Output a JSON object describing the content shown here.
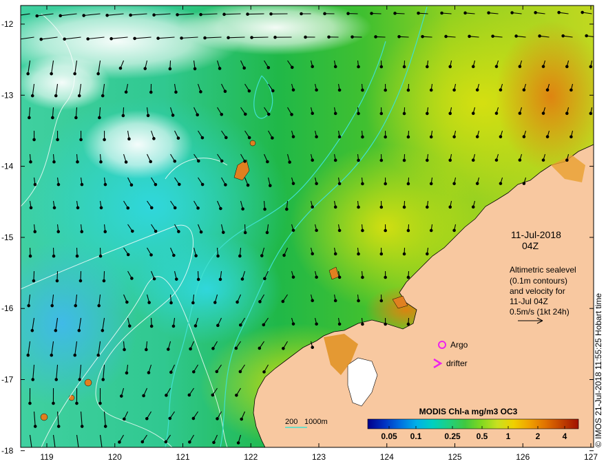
{
  "map": {
    "lat_ticks": [
      "-12",
      "-13",
      "-14",
      "-15",
      "-16",
      "-17",
      "-18"
    ],
    "lon_ticks": [
      "119",
      "120",
      "121",
      "122",
      "123",
      "124",
      "125",
      "126",
      "127"
    ],
    "date": "11-Jul-2018",
    "time": "04Z",
    "info_lines": [
      "Altimetric sealevel",
      "(0.1m contours)",
      "and velocity for",
      "11-Jul 04Z",
      "0.5m/s (1kt 24h)"
    ],
    "legend": {
      "argo_label": "Argo",
      "drifter_label": "drifter",
      "argo_color": "#ee22ee",
      "drifter_color": "#ee22ee"
    },
    "depth_key": {
      "label_200": "200",
      "label_1000": "1000m",
      "color": "#40e0d0"
    },
    "colorbar": {
      "title": "MODIS Chl-a mg/m3 OC3",
      "ticks": [
        "0.05",
        "0.1",
        "0.25",
        "0.5",
        "1",
        "2",
        "4"
      ],
      "colors": [
        "#00008b",
        "#0030c0",
        "#0070e0",
        "#00b0e8",
        "#00d0c0",
        "#20d080",
        "#40c840",
        "#80d820",
        "#c8e020",
        "#f0d000",
        "#f0a000",
        "#e07000",
        "#c04000",
        "#a01000"
      ]
    },
    "credit": "© IMOS 21-Jul-2018 11:55:25 Hobart time",
    "land_color": "#f8c8a0"
  }
}
